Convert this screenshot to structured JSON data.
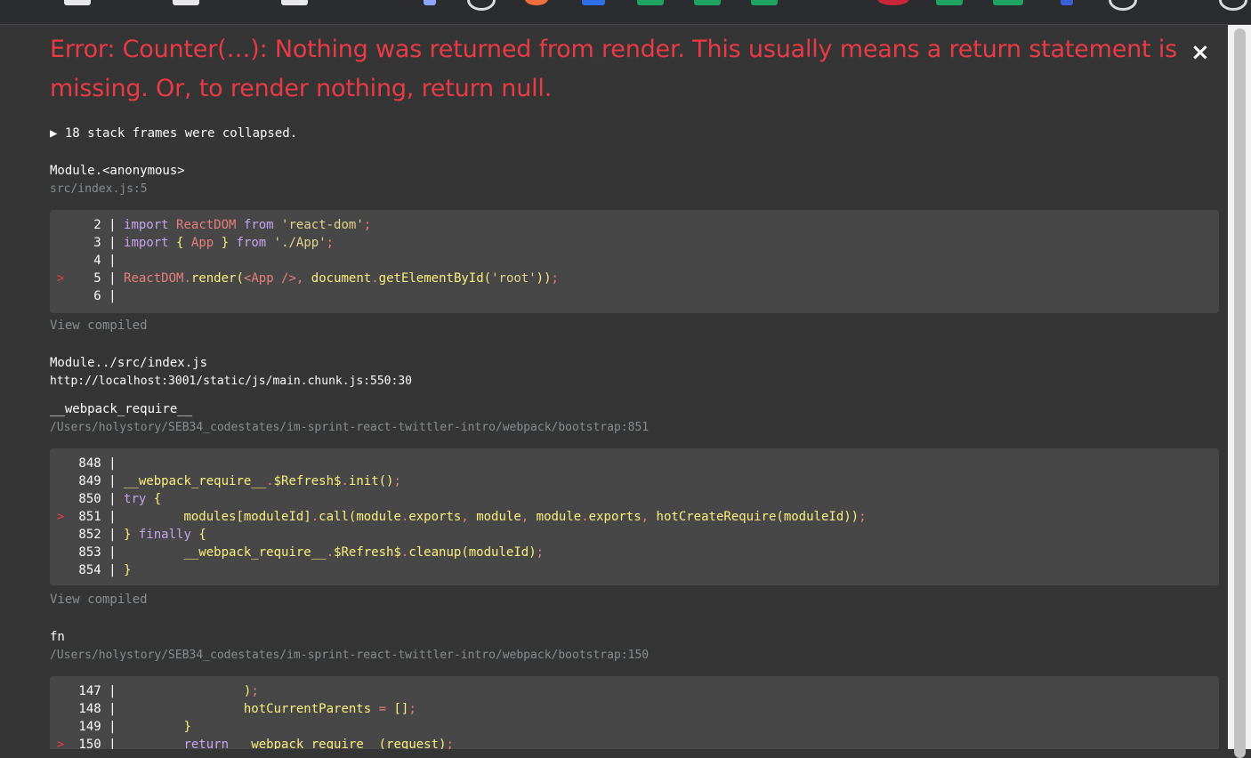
{
  "error": {
    "message": "Error: Counter(…): Nothing was returned from render. This usually means a return statement is missing. Or, to render nothing, return null.",
    "close_label": "×"
  },
  "collapsed_note": "▶ 18 stack frames were collapsed.",
  "view_compiled_label": "View compiled",
  "frames": [
    {
      "name": "Module.<anonymous>",
      "location": "src/index.js:5",
      "code": [
        {
          "marker": "",
          "num": "2",
          "tokens": [
            [
              "kw",
              "import "
            ],
            [
              "red",
              "ReactDOM"
            ],
            [
              "kw",
              " from "
            ],
            [
              "str",
              "'react-dom'"
            ],
            [
              "red",
              ";"
            ]
          ]
        },
        {
          "marker": "",
          "num": "3",
          "tokens": [
            [
              "kw",
              "import "
            ],
            [
              "yl",
              "{ "
            ],
            [
              "red",
              "App"
            ],
            [
              "yl",
              " } "
            ],
            [
              "kw",
              "from "
            ],
            [
              "str",
              "'./App'"
            ],
            [
              "red",
              ";"
            ]
          ]
        },
        {
          "marker": "",
          "num": "4",
          "tokens": []
        },
        {
          "marker": ">",
          "num": "5",
          "tokens": [
            [
              "red",
              "ReactDOM"
            ],
            [
              "red",
              "."
            ],
            [
              "yl",
              "render("
            ],
            [
              "red",
              "<App /"
            ],
            [
              "red",
              ">, "
            ],
            [
              "yl",
              "document"
            ],
            [
              "red",
              "."
            ],
            [
              "yl",
              "getElementById("
            ],
            [
              "str",
              "'root'"
            ],
            [
              "yl",
              "))"
            ],
            [
              "red",
              ";"
            ]
          ]
        },
        {
          "marker": "",
          "num": "6",
          "tokens": []
        }
      ]
    },
    {
      "name": "Module../src/index.js",
      "location": "http://localhost:3001/static/js/main.chunk.js:550:30"
    },
    {
      "name": "__webpack_require__",
      "location": "/Users/holystory/SEB34_codestates/im-sprint-react-twittler-intro/webpack/bootstrap:851",
      "code": [
        {
          "marker": "",
          "num": "848",
          "tokens": []
        },
        {
          "marker": "",
          "num": "849",
          "tokens": [
            [
              "yl",
              "__webpack_require__"
            ],
            [
              "red",
              "."
            ],
            [
              "yl",
              "$Refresh$"
            ],
            [
              "red",
              "."
            ],
            [
              "yl",
              "init()"
            ],
            [
              "red",
              ";"
            ]
          ]
        },
        {
          "marker": "",
          "num": "850",
          "tokens": [
            [
              "kw",
              "try "
            ],
            [
              "yl",
              "{"
            ]
          ]
        },
        {
          "marker": ">",
          "num": "851",
          "tokens": [
            [
              "yl",
              "        modules[moduleId]"
            ],
            [
              "red",
              "."
            ],
            [
              "yl",
              "call(module"
            ],
            [
              "red",
              "."
            ],
            [
              "yl",
              "exports"
            ],
            [
              "red",
              ", "
            ],
            [
              "yl",
              "module"
            ],
            [
              "red",
              ", "
            ],
            [
              "yl",
              "module"
            ],
            [
              "red",
              "."
            ],
            [
              "yl",
              "exports"
            ],
            [
              "red",
              ", "
            ],
            [
              "yl",
              "hotCreateRequire(moduleId))"
            ],
            [
              "red",
              ";"
            ]
          ]
        },
        {
          "marker": "",
          "num": "852",
          "tokens": [
            [
              "yl",
              "} "
            ],
            [
              "kw",
              "finally "
            ],
            [
              "yl",
              "{"
            ]
          ]
        },
        {
          "marker": "",
          "num": "853",
          "tokens": [
            [
              "yl",
              "        __webpack_require__"
            ],
            [
              "red",
              "."
            ],
            [
              "yl",
              "$Refresh$"
            ],
            [
              "red",
              "."
            ],
            [
              "yl",
              "cleanup(moduleId)"
            ],
            [
              "red",
              ";"
            ]
          ]
        },
        {
          "marker": "",
          "num": "854",
          "tokens": [
            [
              "yl",
              "}"
            ]
          ]
        }
      ]
    },
    {
      "name": "fn",
      "location": "/Users/holystory/SEB34_codestates/im-sprint-react-twittler-intro/webpack/bootstrap:150",
      "code": [
        {
          "marker": "",
          "num": "147",
          "tokens": [
            [
              "yl",
              "                )"
            ],
            [
              "red",
              ";"
            ]
          ]
        },
        {
          "marker": "",
          "num": "148",
          "tokens": [
            [
              "yl",
              "                hotCurrentParents "
            ],
            [
              "red",
              "= "
            ],
            [
              "yl",
              "[]"
            ],
            [
              "red",
              ";"
            ]
          ]
        },
        {
          "marker": "",
          "num": "149",
          "tokens": [
            [
              "yl",
              "        }"
            ]
          ]
        },
        {
          "marker": ">",
          "num": "150",
          "tokens": [
            [
              "kw",
              "        return "
            ],
            [
              "yl",
              "__webpack_require__(request)"
            ],
            [
              "red",
              ";"
            ]
          ]
        }
      ]
    }
  ],
  "colors": {
    "error_red": "#e83b46",
    "background": "#353535",
    "code_background": "#474747"
  }
}
